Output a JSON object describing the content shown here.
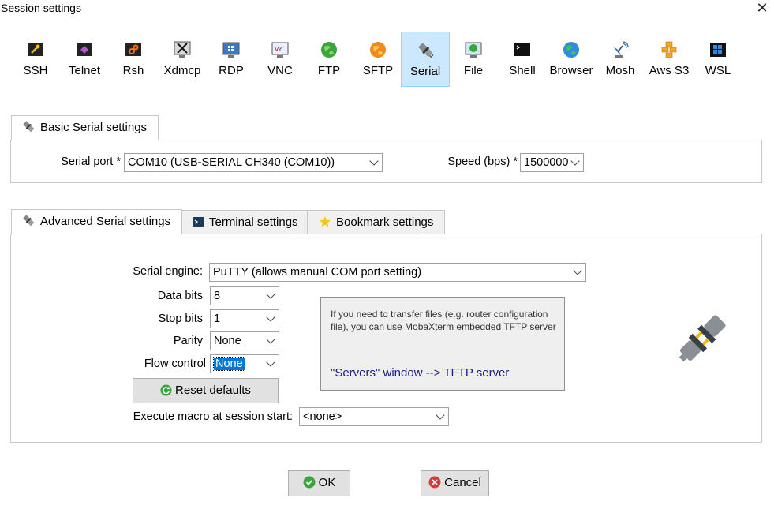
{
  "window": {
    "title": "Session settings",
    "close_icon": "close-icon"
  },
  "protocols": [
    {
      "label": "SSH",
      "icon": "ssh-key-icon"
    },
    {
      "label": "Telnet",
      "icon": "telnet-icon"
    },
    {
      "label": "Rsh",
      "icon": "rsh-icon"
    },
    {
      "label": "Xdmcp",
      "icon": "xdmcp-icon"
    },
    {
      "label": "RDP",
      "icon": "rdp-monitor-icon"
    },
    {
      "label": "VNC",
      "icon": "vnc-icon"
    },
    {
      "label": "FTP",
      "icon": "ftp-globe-icon"
    },
    {
      "label": "SFTP",
      "icon": "sftp-globe-icon"
    },
    {
      "label": "Serial",
      "icon": "serial-plug-icon",
      "selected": true
    },
    {
      "label": "File",
      "icon": "file-monitor-icon"
    },
    {
      "label": "Shell",
      "icon": "shell-terminal-icon"
    },
    {
      "label": "Browser",
      "icon": "browser-globe-icon"
    },
    {
      "label": "Mosh",
      "icon": "mosh-satellite-icon"
    },
    {
      "label": "Aws S3",
      "icon": "aws-s3-icon"
    },
    {
      "label": "WSL",
      "icon": "wsl-windows-icon"
    }
  ],
  "basic": {
    "tab_label": "Basic Serial settings",
    "serial_port_label": "Serial port *",
    "serial_port_value": "COM10  (USB-SERIAL CH340 (COM10))",
    "speed_label": "Speed (bps) *",
    "speed_value": "1500000"
  },
  "tabs": {
    "advanced": "Advanced Serial settings",
    "terminal": "Terminal settings",
    "bookmark": "Bookmark settings"
  },
  "advanced": {
    "engine_label": "Serial engine:",
    "engine_value": "PuTTY    (allows manual COM port setting)",
    "data_bits_label": "Data bits",
    "data_bits_value": "8",
    "stop_bits_label": "Stop bits",
    "stop_bits_value": "1",
    "parity_label": "Parity",
    "parity_value": "None",
    "flow_label": "Flow control",
    "flow_value": "None",
    "reset_label": "Reset defaults",
    "macro_label": "Execute macro at session start:",
    "macro_value": "<none>",
    "info_text": "If you need to transfer files (e.g. router configuration file), you can use MobaXterm embedded TFTP server",
    "info_link": "\"Servers\" window  -->  TFTP server"
  },
  "footer": {
    "ok_label": "OK",
    "cancel_label": "Cancel"
  },
  "colors": {
    "selected_bg": "#cce8ff",
    "selection": "#0078d7",
    "link": "#1a1a8c"
  }
}
